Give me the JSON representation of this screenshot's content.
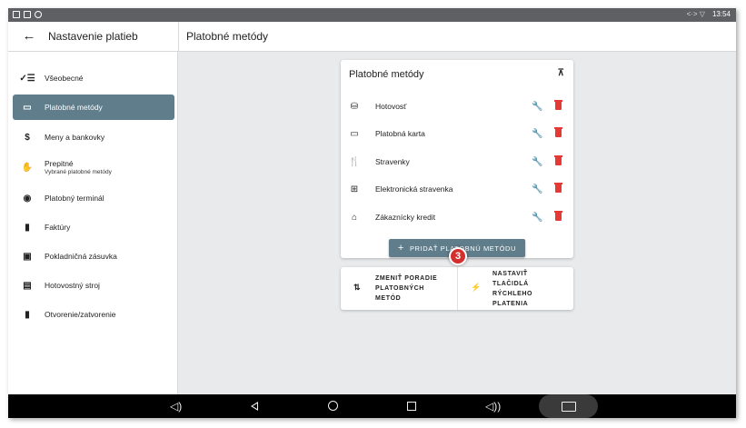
{
  "status_bar": {
    "time": "13:54",
    "signal": "<·> ▽"
  },
  "header": {
    "back_icon": "arrow-left-icon",
    "settings_title": "Nastavenie platieb",
    "section_title": "Platobné metódy"
  },
  "sidebar": {
    "items": [
      {
        "label": "Všeobecné",
        "icon": "checklist-icon",
        "glyph": "✓☰"
      },
      {
        "label": "Platobné metódy",
        "icon": "card-icon",
        "glyph": "▭",
        "active": true
      },
      {
        "label": "Meny a bankovky",
        "icon": "dollar-icon",
        "glyph": "$"
      },
      {
        "label": "Prepitné",
        "sublabel": "Vybrané platobné metódy",
        "icon": "tip-hand-icon",
        "glyph": "✋"
      },
      {
        "label": "Platobný terminál",
        "icon": "contactless-icon",
        "glyph": "◉"
      },
      {
        "label": "Faktúry",
        "icon": "document-icon",
        "glyph": "▮"
      },
      {
        "label": "Pokladničná zásuvka",
        "icon": "drawer-icon",
        "glyph": "▣"
      },
      {
        "label": "Hotovostný stroj",
        "icon": "cash-machine-icon",
        "glyph": "▤"
      },
      {
        "label": "Otvorenie/zatvorenie",
        "icon": "door-icon",
        "glyph": "▮"
      }
    ]
  },
  "methods_card": {
    "title": "Platobné metódy",
    "collapse_icon": "collapse-vertical-icon",
    "methods": [
      {
        "name": "Hotovosť",
        "icon": "coins-icon",
        "glyph": "⛁"
      },
      {
        "name": "Platobná karta",
        "icon": "credit-card-icon",
        "glyph": "▭"
      },
      {
        "name": "Stravenky",
        "icon": "cutlery-icon",
        "glyph": "🍴"
      },
      {
        "name": "Elektronická stravenka",
        "icon": "electronic-voucher-icon",
        "glyph": "⊞"
      },
      {
        "name": "Zákaznícky kredit",
        "icon": "tag-icon",
        "glyph": "⌂"
      }
    ],
    "add_button": "PRIDAŤ PLATOBNÚ METÓDU",
    "badge": "3"
  },
  "actions_card": {
    "reorder_label": "ZMENIŤ PORADIE PLATOBNÝCH METÓD",
    "reorder_lines": [
      "ZMENIŤ PORADIE",
      "PLATOBNÝCH",
      "METÓD"
    ],
    "quick_label": "NASTAVIŤ TLAČIDLÁ RÝCHLEHO PLATENIA",
    "quick_lines": [
      "NASTAVIŤ",
      "TLAČIDLÁ",
      "RÝCHLEHO",
      "PLATENIA"
    ]
  },
  "colors": {
    "accent": "#607d8b",
    "danger": "#e53935",
    "badge": "#d32f2f"
  }
}
